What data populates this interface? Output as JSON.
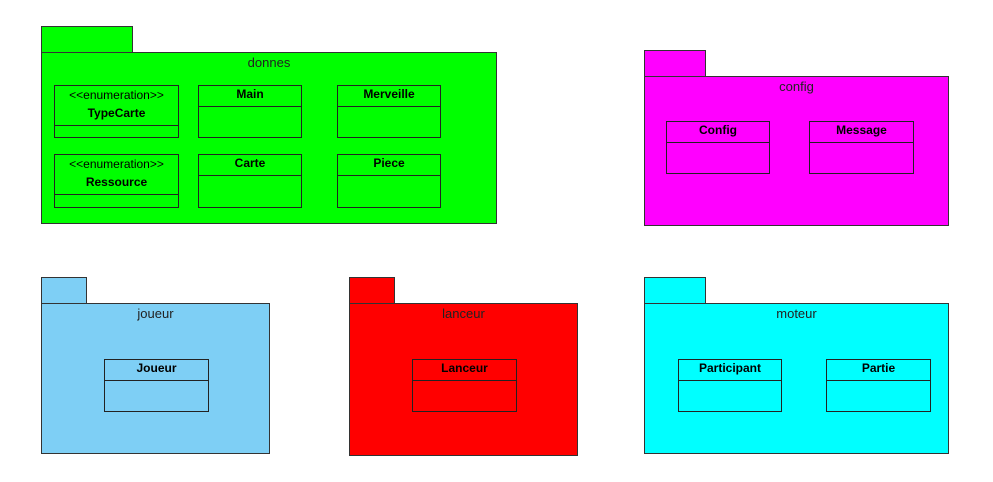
{
  "packages": {
    "donnes": {
      "name": "donnes",
      "color": "#00ff00",
      "classes": [
        {
          "stereotype": "<<enumeration>>",
          "name": "TypeCarte"
        },
        {
          "name": "Main"
        },
        {
          "name": "Merveille"
        },
        {
          "stereotype": "<<enumeration>>",
          "name": "Ressource"
        },
        {
          "name": "Carte"
        },
        {
          "name": "Piece"
        }
      ]
    },
    "config": {
      "name": "config",
      "color": "#ff00ff",
      "classes": [
        {
          "name": "Config"
        },
        {
          "name": "Message"
        }
      ]
    },
    "joueur": {
      "name": "joueur",
      "color": "#7ecff5",
      "classes": [
        {
          "name": "Joueur"
        }
      ]
    },
    "lanceur": {
      "name": "lanceur",
      "color": "#ff0000",
      "classes": [
        {
          "name": "Lanceur"
        }
      ]
    },
    "moteur": {
      "name": "moteur",
      "color": "#00ffff",
      "classes": [
        {
          "name": "Participant"
        },
        {
          "name": "Partie"
        }
      ]
    }
  }
}
